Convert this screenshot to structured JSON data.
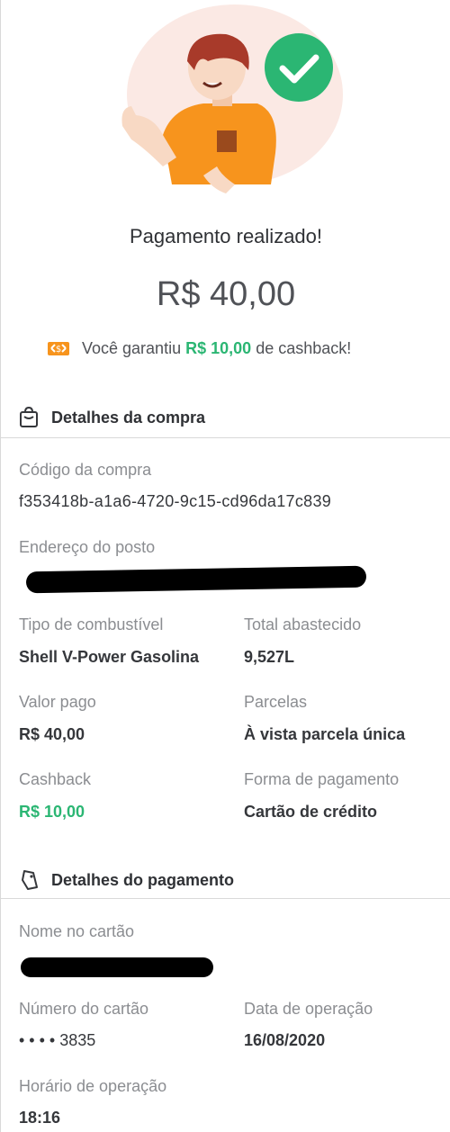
{
  "header": {
    "title": "Pagamento realizado!",
    "amount": "R$ 40,00",
    "cashback_prefix": "Você garantiu ",
    "cashback_amount": "R$ 10,00",
    "cashback_suffix": " de cashback!"
  },
  "purchase": {
    "section_title": "Detalhes da compra",
    "code_label": "Código da compra",
    "code_value": "f353418b-a1a6-4720-9c15-cd96da17c839",
    "address_label": "Endereço do posto",
    "fuel_label": "Tipo de combustível",
    "fuel_value": "Shell V-Power Gasolina",
    "total_label": "Total abastecido",
    "total_value": "9,527L",
    "paid_label": "Valor pago",
    "paid_value": "R$ 40,00",
    "installments_label": "Parcelas",
    "installments_value": "À vista parcela única",
    "cashback_label": "Cashback",
    "cashback_value": "R$ 10,00",
    "method_label": "Forma de pagamento",
    "method_value": "Cartão de crédito"
  },
  "payment": {
    "section_title": "Detalhes do pagamento",
    "name_label": "Nome no cartão",
    "card_label": "Número do cartão",
    "card_value": "• • • • 3835",
    "date_label": "Data de operação",
    "date_value": "16/08/2020",
    "time_label": "Horário de operação",
    "time_value": "18:16"
  },
  "colors": {
    "accent_green": "#2bb673",
    "orange": "#f7941d",
    "hair": "#a83a2a"
  },
  "icons": [
    "character-illustration",
    "check-badge-icon",
    "cashback-icon",
    "shopping-bag-icon",
    "card-tag-icon"
  ]
}
